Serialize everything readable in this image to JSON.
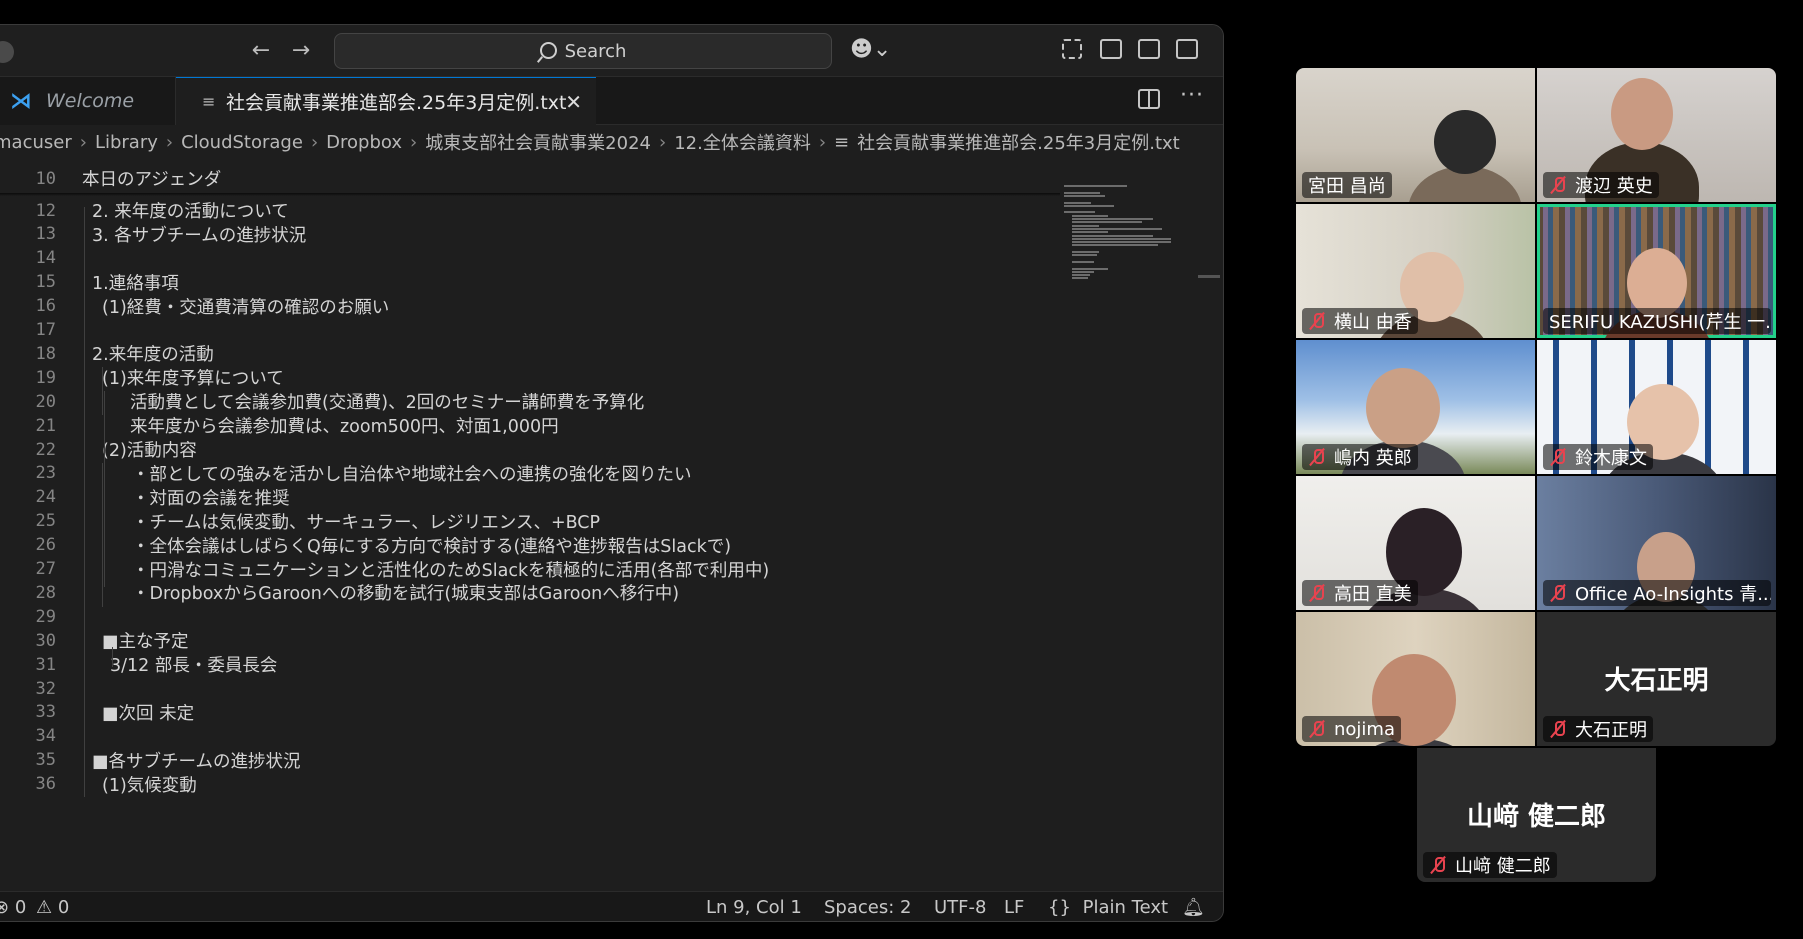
{
  "editor": {
    "search_placeholder": "Search",
    "tabs": [
      {
        "label": "Welcome"
      },
      {
        "label": "社会貢献事業推進部会.25年3月定例.txt"
      }
    ],
    "breadcrumb": [
      "macuser",
      "Library",
      "CloudStorage",
      "Dropbox",
      "城東支部社会貢献事業2024",
      "12.全体会議資料",
      "社会貢献事業推進部会.25年3月定例.txt"
    ],
    "lines": [
      {
        "n": "10",
        "text": "本日のアジェンダ"
      },
      {
        "n": "12",
        "text": "2. 来年度の活動について"
      },
      {
        "n": "13",
        "text": "3. 各サブチームの進捗状況"
      },
      {
        "n": "14",
        "text": ""
      },
      {
        "n": "15",
        "text": "1.連絡事項"
      },
      {
        "n": "16",
        "text": "(1)経費・交通費清算の確認のお願い"
      },
      {
        "n": "17",
        "text": ""
      },
      {
        "n": "18",
        "text": "2.来年度の活動"
      },
      {
        "n": "19",
        "text": "(1)来年度予算について"
      },
      {
        "n": "20",
        "text": "活動費として会議参加費(交通費)、2回のセミナー講師費を予算化"
      },
      {
        "n": "21",
        "text": "来年度から会議参加費は、zoom500円、対面1,000円"
      },
      {
        "n": "22",
        "text": "(2)活動内容"
      },
      {
        "n": "23",
        "text": "・部としての強みを活かし自治体や地域社会への連携の強化を図りたい"
      },
      {
        "n": "24",
        "text": "・対面の会議を推奨"
      },
      {
        "n": "25",
        "text": "・チームは気候変動、サーキュラー、レジリエンス、+BCP"
      },
      {
        "n": "26",
        "text": "・全体会議はしばらくQ毎にする方向で検討する(連絡や進捗報告はSlackで)"
      },
      {
        "n": "27",
        "text": "・円滑なコミュニケーションと活性化のためSlackを積極的に活用(各部で利用中)"
      },
      {
        "n": "28",
        "text": "・DropboxからGaroonへの移動を試行(城東支部はGaroonへ移行中)"
      },
      {
        "n": "29",
        "text": ""
      },
      {
        "n": "30",
        "text": "■主な予定"
      },
      {
        "n": "31",
        "text": "3/12 部長・委員長会"
      },
      {
        "n": "32",
        "text": ""
      },
      {
        "n": "33",
        "text": "■次回 未定"
      },
      {
        "n": "34",
        "text": ""
      },
      {
        "n": "35",
        "text": "■各サブチームの進捗状況"
      },
      {
        "n": "36",
        "text": "(1)気候変動"
      }
    ],
    "status": {
      "errors": "0",
      "warnings": "0",
      "position": "Ln 9, Col 1",
      "spaces": "Spaces: 2",
      "encoding": "UTF-8",
      "eol": "LF",
      "language": "Plain Text"
    }
  },
  "meeting": {
    "participants": [
      {
        "name": "宮田 昌尚",
        "muted": false
      },
      {
        "name": "渡辺 英史",
        "muted": true
      },
      {
        "name": "横山 由香",
        "muted": true
      },
      {
        "name": "SERIFU KAZUSHI(芹生 一...",
        "muted": false
      },
      {
        "name": "嶋内 英郎",
        "muted": true
      },
      {
        "name": "鈴木康文",
        "muted": true
      },
      {
        "name": "高田 直美",
        "muted": true
      },
      {
        "name": "Office Ao-Insights 青...",
        "muted": true
      },
      {
        "name": "nojima",
        "muted": true
      },
      {
        "name": "大石正明",
        "muted": true,
        "big": "大石正明"
      },
      {
        "name": "山﨑 健二郎",
        "muted": true,
        "big": "山﨑 健二郎"
      }
    ],
    "active_speaker_color": "#23d18b"
  }
}
